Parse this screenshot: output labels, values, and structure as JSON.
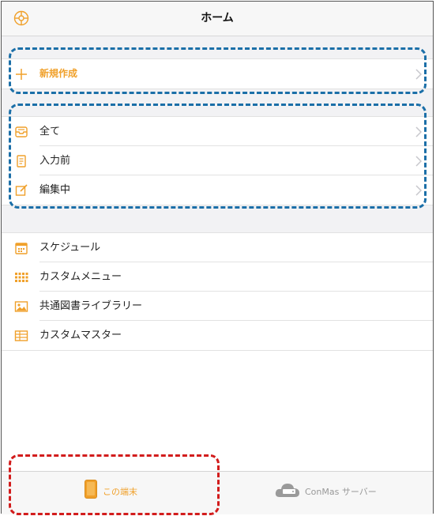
{
  "header": {
    "title": "ホーム",
    "settings_icon": "gear-icon"
  },
  "sections": {
    "create": {
      "label": "新規作成",
      "icon": "plus-icon"
    },
    "forms": [
      {
        "label": "全て",
        "icon": "inbox-icon"
      },
      {
        "label": "入力前",
        "icon": "document-icon"
      },
      {
        "label": "編集中",
        "icon": "edit-icon"
      }
    ],
    "tools": [
      {
        "label": "スケジュール",
        "icon": "calendar-icon"
      },
      {
        "label": "カスタムメニュー",
        "icon": "grid-icon"
      },
      {
        "label": "共通図書ライブラリー",
        "icon": "image-icon"
      },
      {
        "label": "カスタムマスター",
        "icon": "table-icon"
      }
    ]
  },
  "tabbar": {
    "local": {
      "label": "この端末",
      "icon": "tablet-icon",
      "selected": true
    },
    "server": {
      "label": "ConMas サーバー",
      "icon": "cloud-server-icon",
      "selected": false
    }
  },
  "colors": {
    "accent": "#f0a02a",
    "annotation_blue": "#1b6fa8",
    "annotation_red": "#d21c1c",
    "inactive": "#999999"
  }
}
